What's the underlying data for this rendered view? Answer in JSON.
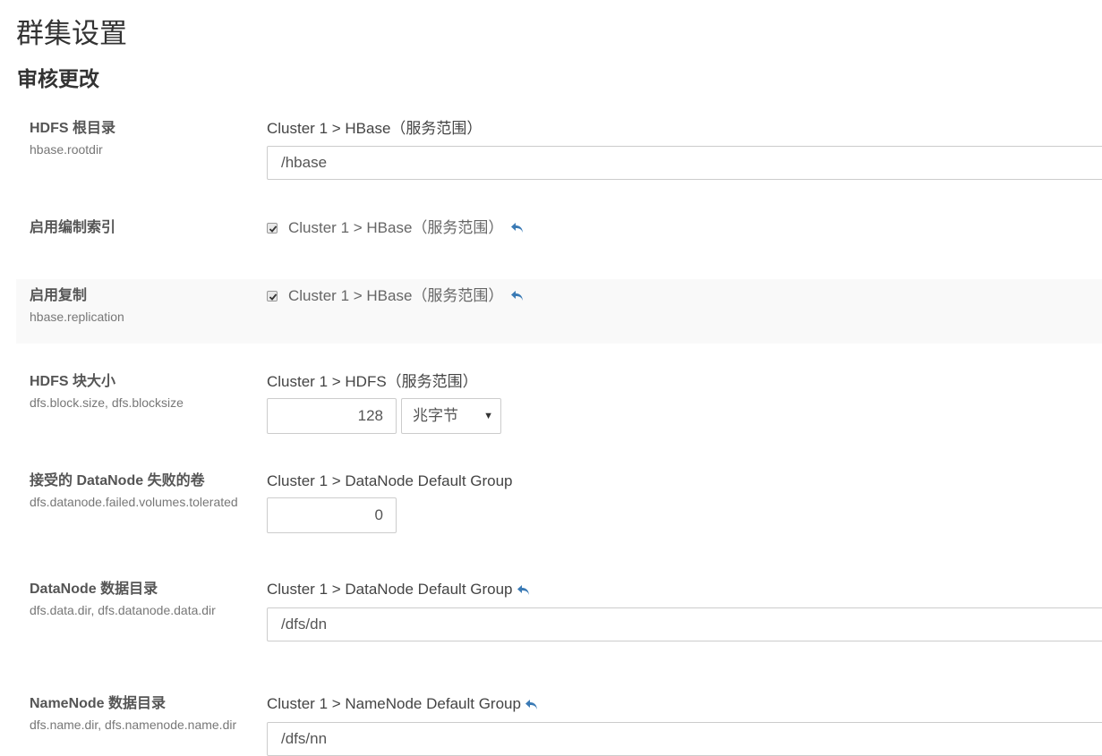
{
  "page": {
    "title": "群集设置",
    "section": "审核更改"
  },
  "rows": [
    {
      "name": "HDFS 根目录",
      "key": "hbase.rootdir",
      "scope": "Cluster 1 > HBase（服务范围）",
      "value": "/hbase"
    },
    {
      "name": "启用编制索引",
      "scope": "Cluster 1 > HBase（服务范围）",
      "checked": true,
      "icon": "undo-icon"
    },
    {
      "name": "启用复制",
      "key": "hbase.replication",
      "scope": "Cluster 1 > HBase（服务范围）",
      "checked": true,
      "icon": "undo-icon"
    },
    {
      "name": "HDFS 块大小",
      "key": "dfs.block.size, dfs.blocksize",
      "scope": "Cluster 1 > HDFS（服务范围）",
      "value": "128",
      "unit": "兆字节"
    },
    {
      "name": "接受的 DataNode 失败的卷",
      "key": "dfs.datanode.failed.volumes.tolerated",
      "scope": "Cluster 1 > DataNode Default Group",
      "value": "0"
    },
    {
      "name": "DataNode 数据目录",
      "key": "dfs.data.dir, dfs.datanode.data.dir",
      "scope": "Cluster 1 > DataNode Default Group",
      "value": "/dfs/dn",
      "icon": "undo-icon"
    },
    {
      "name": "NameNode 数据目录",
      "key": "dfs.name.dir, dfs.namenode.name.dir",
      "scope": "Cluster 1 > NameNode Default Group",
      "value": "/dfs/nn",
      "icon": "undo-icon"
    }
  ],
  "colors": {
    "accent": "#3a7ab5",
    "shaded_row": "#f9f9f9",
    "border": "#cccccc"
  }
}
